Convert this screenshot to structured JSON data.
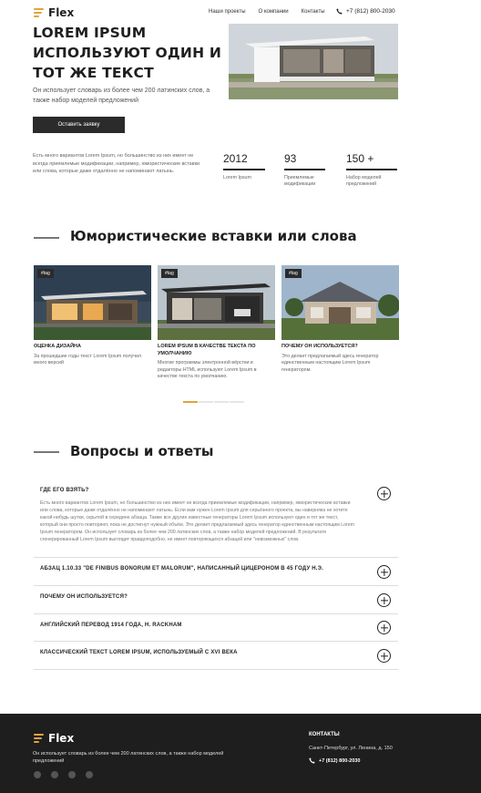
{
  "header": {
    "logo": "Flex",
    "nav": [
      "Наши проекты",
      "О компании",
      "Контакты"
    ],
    "phone": "+7 (812) 800-2030"
  },
  "hero": {
    "title": "LOREM IPSUM ИСПОЛЬЗУЮТ ОДИН И ТОТ ЖЕ ТЕКСТ",
    "subtitle": "Он использует словарь из более чем 200 латинских слов, а также набор моделей предложений",
    "button": "Оставить заявку",
    "intro": "Есть много вариантов Lorem Ipsum, но большинство из них имеет не всегда приемлемые модификации, например, юмористические вставки или слова, которые даже отдалённо не напоминают латынь."
  },
  "stats": [
    {
      "value": "2012",
      "label": "Lorem Ipsum"
    },
    {
      "value": "93",
      "label": "Приемлемые модификации"
    },
    {
      "value": "150 +",
      "label": "Набор моделей предложений"
    }
  ],
  "projects": {
    "title": "Юмористические вставки или слова",
    "cards": [
      {
        "tag": "#tag",
        "title": "ОЦЕНКА ДИЗАЙНА",
        "desc": "За прошедшие годы текст Lorem Ipsum получил много версий"
      },
      {
        "tag": "#tag",
        "title": "LOREM IPSUM В КАЧЕСТВЕ ТЕКСТА ПО УМОЛЧАНИЮ",
        "desc": "Многие программы электронной вёрстки и редакторы HTML используют Lorem Ipsum в качестве текста по умолчанию."
      },
      {
        "tag": "#tag",
        "title": "ПОЧЕМУ ОН ИСПОЛЬЗУЕТСЯ?",
        "desc": "Это делает предлагаемый здесь генератор единственным настоящим Lorem Ipsum генератором."
      }
    ]
  },
  "faq": {
    "title": "Вопросы и ответы",
    "items": [
      {
        "q": "ГДЕ ЕГО ВЗЯТЬ?",
        "a": "Есть много вариантов Lorem Ipsum, но большинство из них имеет не всегда приемлемые модификации, например, юмористические вставки или слова, которые даже отдалённо не напоминают латынь. Если вам нужен Lorem Ipsum для серьёзного проекта, вы наверняка не хотите какой-нибудь шутки, скрытой в середине абзаца. Также все другие известные генераторы Lorem Ipsum используют один и тот же текст, который они просто повторяют, пока не достигнут нужный объём. Это делает предлагаемый здесь генератор единственным настоящим Lorem Ipsum генератором. Он использует словарь из более чем 200 латинских слов, а также набор моделей предложений. В результате сгенерированный Lorem Ipsum выглядит правдоподобно, не имеет повторяющихся абзацей или \"невозможных\" слов."
      },
      {
        "q": "АБЗАЦ 1.10.33 \"DE FINIBUS BONORUM ET MALORUM\", НАПИСАННЫЙ ЦИЦЕРОНОМ В 45 ГОДУ Н.Э.",
        "a": ""
      },
      {
        "q": "ПОЧЕМУ ОН ИСПОЛЬЗУЕТСЯ?",
        "a": ""
      },
      {
        "q": "АНГЛИЙСКИЙ ПЕРЕВОД 1914 ГОДА, H. RACKHAM",
        "a": ""
      },
      {
        "q": "КЛАССИЧЕСКИЙ ТЕКСТ LOREM IPSUM, ИСПОЛЬЗУЕМЫЙ С XVI ВЕКА",
        "a": ""
      }
    ]
  },
  "footer": {
    "logo": "Flex",
    "desc": "Он использует словарь из более чем 200 латинских слов, а также набор моделей предложений",
    "contacts_title": "КОНТАКТЫ",
    "address": "Санкт-Петербург, ул. Ленина, д. 150",
    "phone": "+7 (812) 800-2030",
    "social": [
      "facebook-icon",
      "twitter-icon",
      "instagram-icon",
      "github-icon"
    ]
  },
  "colors": {
    "accent": "#e0a43a",
    "dark": "#2b2b2b",
    "footer": "#1e1e1e"
  }
}
